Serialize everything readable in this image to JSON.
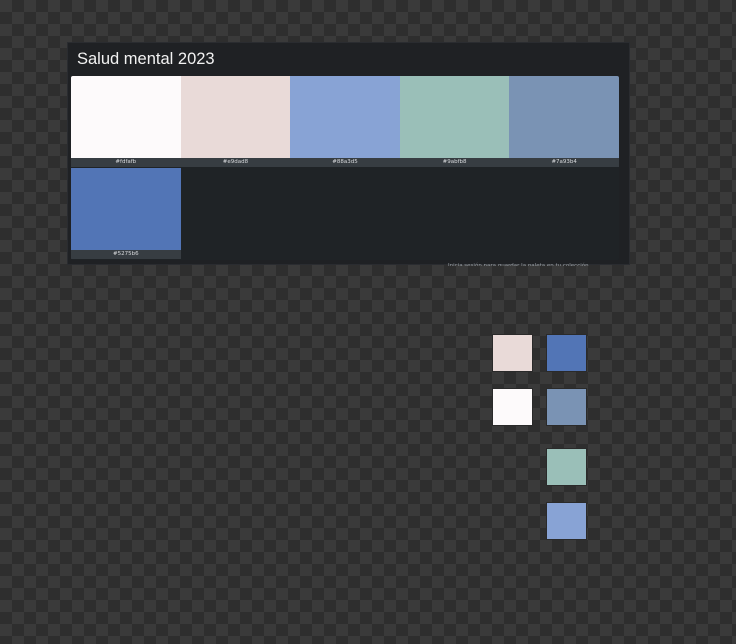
{
  "palette": {
    "title": "Salud mental 2023",
    "swatches": [
      {
        "hex": "#fdfafb",
        "label": "#fdfafb"
      },
      {
        "hex": "#e9dad8",
        "label": "#e9dad8"
      },
      {
        "hex": "#88a3d5",
        "label": "#88a3d5"
      },
      {
        "hex": "#9abfb8",
        "label": "#9abfb8"
      },
      {
        "hex": "#7a93b4",
        "label": "#7a93b4"
      },
      {
        "hex": "#5275b6",
        "label": "#5275b6"
      }
    ],
    "hint": "Inicia sesión para guardar la paleta en tu colección"
  },
  "chips": [
    {
      "color": "#e9dad8"
    },
    {
      "color": "#5275b6"
    },
    {
      "color": "#fdfafb"
    },
    {
      "color": "#7a93b4"
    },
    {
      "color": "#9abfb8"
    },
    {
      "color": "#88a3d5"
    }
  ],
  "colors": {
    "card_background": "#1f2124",
    "checker_light": "#3a3a3a",
    "checker_dark": "#2e2e2e"
  }
}
